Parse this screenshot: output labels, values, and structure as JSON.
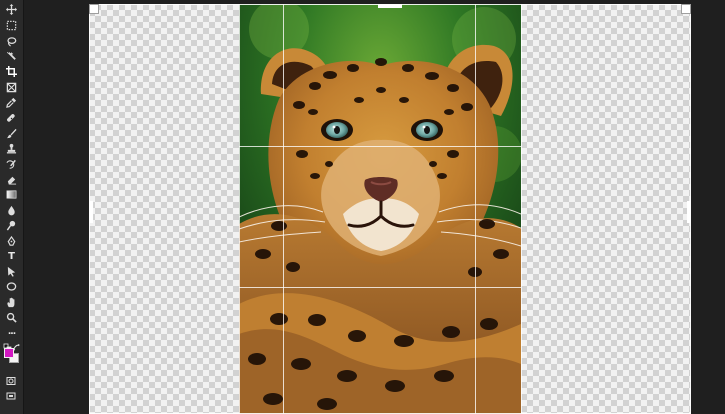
{
  "app": {
    "title": "",
    "toolbar": {
      "tools": [
        {
          "name": "move-tool",
          "icon": "move-icon"
        },
        {
          "name": "marquee-tool",
          "icon": "marquee-icon"
        },
        {
          "name": "lasso-tool",
          "icon": "lasso-icon"
        },
        {
          "name": "magic-wand-tool",
          "icon": "magic-wand-icon"
        },
        {
          "name": "crop-tool",
          "icon": "crop-icon"
        },
        {
          "name": "frame-tool",
          "icon": "frame-icon"
        },
        {
          "name": "eyedropper-tool",
          "icon": "eyedropper-icon"
        },
        {
          "name": "healing-brush-tool",
          "icon": "healing-brush-icon"
        },
        {
          "name": "brush-tool",
          "icon": "brush-icon"
        },
        {
          "name": "clone-stamp-tool",
          "icon": "stamp-icon"
        },
        {
          "name": "history-brush-tool",
          "icon": "history-brush-icon"
        },
        {
          "name": "eraser-tool",
          "icon": "eraser-icon"
        },
        {
          "name": "gradient-tool",
          "icon": "gradient-icon"
        },
        {
          "name": "blur-tool",
          "icon": "drop-icon"
        },
        {
          "name": "dodge-tool",
          "icon": "dodge-icon"
        },
        {
          "name": "pen-tool",
          "icon": "pen-icon"
        },
        {
          "name": "type-tool",
          "icon": "type-icon",
          "label": "T"
        },
        {
          "name": "path-selection-tool",
          "icon": "arrow-icon"
        },
        {
          "name": "shape-tool",
          "icon": "ellipse-icon"
        },
        {
          "name": "hand-tool",
          "icon": "hand-icon"
        },
        {
          "name": "zoom-tool",
          "icon": "zoom-icon"
        },
        {
          "name": "more-tools",
          "icon": "ellipsis-icon",
          "label": "..."
        }
      ],
      "foreground_color": "#d318c2",
      "background_color": "#f4f4f4"
    },
    "canvas": {
      "background": "#f2f2f2",
      "checker_color": "#d2d2d2",
      "crop_grid": true
    }
  }
}
